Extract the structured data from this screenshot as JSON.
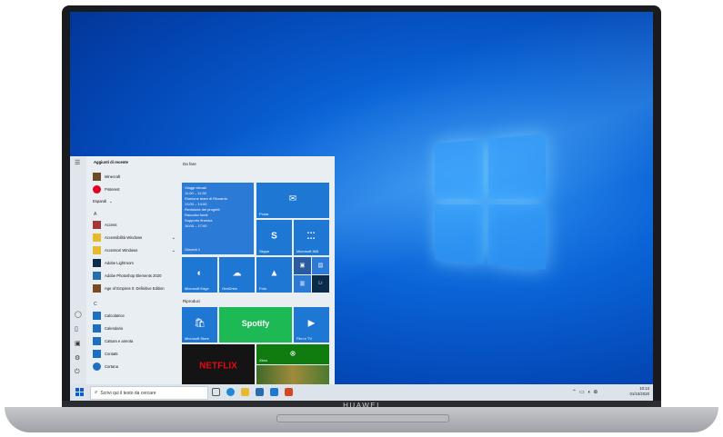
{
  "device": {
    "brand": "HUAWEI"
  },
  "start_menu": {
    "recent_header": "Aggiunti di recente",
    "recent": [
      {
        "label": "Minecraft",
        "icon": "minecraft-icon",
        "color": "#6b4b2a"
      },
      {
        "label": "Pinterest",
        "icon": "pinterest-icon",
        "color": "#e60023"
      }
    ],
    "expand_label": "Espandi",
    "sections": [
      {
        "letter": "A",
        "apps": [
          {
            "label": "Access",
            "icon": "access-icon",
            "color": "#a4373a",
            "chevron": ""
          },
          {
            "label": "Accessibilità Windows",
            "icon": "folder-icon",
            "color": "#e8b92c",
            "chevron": "⌄"
          },
          {
            "label": "Accessori Windows",
            "icon": "folder-icon",
            "color": "#e8b92c",
            "chevron": "⌄"
          },
          {
            "label": "Adobe Lightroom",
            "icon": "lightroom-icon",
            "color": "#0c2a4a",
            "chevron": ""
          },
          {
            "label": "Adobe Photoshop Elements 2020",
            "icon": "photoshop-icon",
            "color": "#2a6cb0",
            "chevron": ""
          },
          {
            "label": "Age of Empires II: Definitive Edition",
            "icon": "aoe-icon",
            "color": "#7a4a22",
            "chevron": ""
          }
        ]
      },
      {
        "letter": "C",
        "apps": [
          {
            "label": "Calcolatrice",
            "icon": "calculator-icon",
            "color": "#1e6fc0",
            "chevron": ""
          },
          {
            "label": "Calendario",
            "icon": "calendar-icon",
            "color": "#1e6fc0",
            "chevron": ""
          },
          {
            "label": "Cattura e annota",
            "icon": "snip-icon",
            "color": "#1e6fc0",
            "chevron": ""
          },
          {
            "label": "Contatti",
            "icon": "contacts-icon",
            "color": "#1e6fc0",
            "chevron": ""
          },
          {
            "label": "Cortana",
            "icon": "cortana-icon",
            "color": "#1e6fc0",
            "chevron": ""
          }
        ]
      }
    ],
    "tiles": {
      "group1": "Da fare",
      "group2": "Riproduci",
      "calendar_lines": [
        "Viaggi virtuali",
        "11:00 – 11:30",
        "Riunione team di Riccardo",
        "13:00 – 14:00",
        "Revisione dei progetti",
        "Raccolta fondi",
        "Supporto finestra",
        "16:00 – 17:00"
      ],
      "calendar_day": "Giovedì 1",
      "mail": "Posta",
      "skype": "Skype",
      "office": "Microsoft 365",
      "edge": "Microsoft Edge",
      "onedrive": "OneDrive",
      "photos": "Foto",
      "store": "Microsoft Store",
      "spotify": "Spotify",
      "films": "Film e TV",
      "netflix": "NETFLIX",
      "xbox": "Xbox"
    }
  },
  "taskbar": {
    "search_placeholder": "Scrivi qui il testo da cercare",
    "time": "10:13",
    "date": "01/10/2020"
  }
}
